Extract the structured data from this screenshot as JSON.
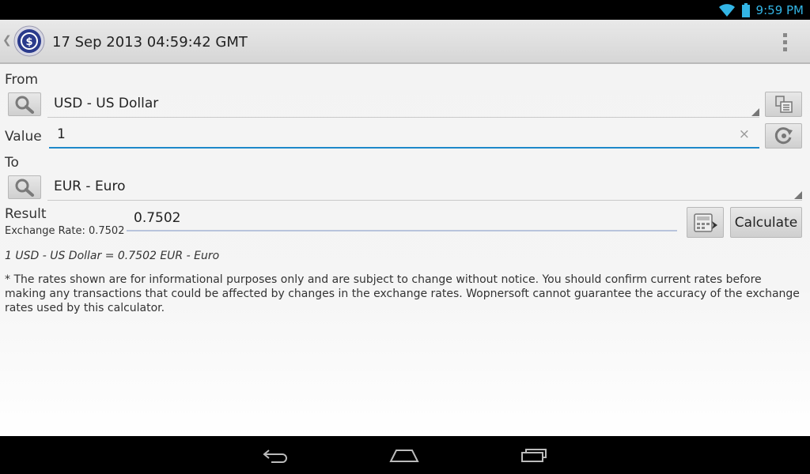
{
  "status_bar": {
    "time": "9:59 PM"
  },
  "action_bar": {
    "title": "17 Sep 2013 04:59:42 GMT"
  },
  "from": {
    "label": "From",
    "currency": "USD - US Dollar"
  },
  "value": {
    "label": "Value",
    "input": "1",
    "clear": "×"
  },
  "to": {
    "label": "To",
    "currency": "EUR - Euro"
  },
  "result": {
    "label": "Result",
    "rate_label": "Exchange Rate: 0.7502",
    "value": "0.7502",
    "calculate_label": "Calculate"
  },
  "summary": "1 USD - US Dollar = 0.7502 EUR - Euro",
  "disclaimer": "* The rates shown are for informational purposes only and are subject to change without notice. You should confirm current rates before making any transactions that could be affected by changes in the exchange rates. Wopnersoft cannot guarantee the accuracy of the exchange rates used by this calculator.",
  "colors": {
    "accent": "#33b5e5",
    "focus_underline": "#1e88c9"
  },
  "icons": [
    "wifi-icon",
    "battery-icon",
    "app-dollar-icon",
    "overflow-menu-icon",
    "search-icon",
    "currency-list-icon",
    "swap-refresh-icon",
    "calculator-icon",
    "back-icon",
    "home-icon",
    "recents-icon"
  ]
}
